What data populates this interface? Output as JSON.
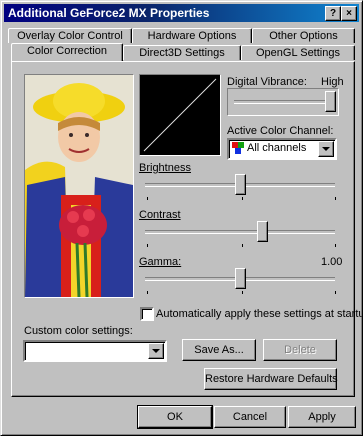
{
  "window": {
    "title": "Additional GeForce2 MX Properties",
    "help_label": "?",
    "close_label": "×"
  },
  "tabs_back": [
    "Overlay Color Control",
    "Hardware Options",
    "Other Options"
  ],
  "tabs_front": [
    "Color Correction",
    "Direct3D Settings",
    "OpenGL Settings"
  ],
  "active_tab": "Color Correction",
  "panel": {
    "digital_vibrance": {
      "label": "Digital Vibrance:",
      "value_label": "High",
      "level": 1.0
    },
    "active_channel": {
      "label": "Active Color Channel:",
      "value": "All channels"
    },
    "brightness": {
      "label": "Brightness",
      "level": 0.5
    },
    "contrast": {
      "label": "Contrast",
      "level": 0.62
    },
    "gamma": {
      "label": "Gamma:",
      "value": "1.00",
      "level": 0.5
    },
    "auto_apply": {
      "label": "Automatically apply these settings at startup",
      "checked": false
    },
    "custom": {
      "label": "Custom color settings:",
      "value": ""
    },
    "save_as": "Save As...",
    "delete": "Delete",
    "restore": "Restore Hardware Defaults"
  },
  "footer": {
    "ok": "OK",
    "cancel": "Cancel",
    "apply": "Apply"
  }
}
